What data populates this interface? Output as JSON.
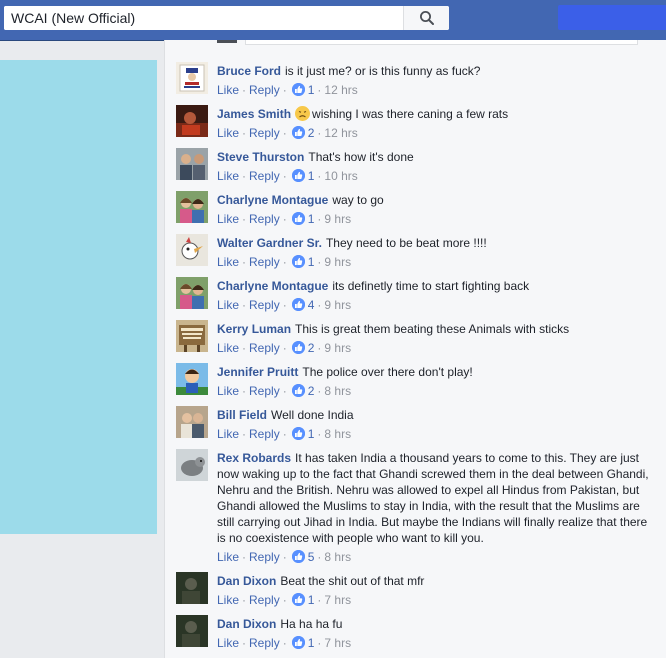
{
  "search": {
    "value": "WCAI (New Official)"
  },
  "actions": {
    "like": "Like",
    "reply": "Reply",
    "dot": "·"
  },
  "comments": [
    {
      "author": "Bruce Ford",
      "text": "is it just me? or is this funny as fuck?",
      "likes": "1",
      "time": "12 hrs",
      "avatar": "uncle-sam"
    },
    {
      "author": "James Smith",
      "text": "wishing I was there caning a few rats",
      "likes": "2",
      "time": "12 hrs",
      "avatar": "dark-red",
      "emoji": "persevering-face-icon"
    },
    {
      "author": "Steve Thurston",
      "text": "That's how it's done",
      "likes": "1",
      "time": "10 hrs",
      "avatar": "two-men"
    },
    {
      "author": "Charlyne Montague",
      "text": "way to go",
      "likes": "1",
      "time": "9 hrs",
      "avatar": "two-women"
    },
    {
      "author": "Walter Gardner Sr.",
      "text": "They need to be beat more !!!!",
      "likes": "1",
      "time": "9 hrs",
      "avatar": "cartoon-bird"
    },
    {
      "author": "Charlyne Montague",
      "text": "its definetly time to start fighting back",
      "likes": "4",
      "time": "9 hrs",
      "avatar": "two-women"
    },
    {
      "author": "Kerry Luman",
      "text": "This is great them beating these Animals with sticks",
      "likes": "2",
      "time": "9 hrs",
      "avatar": "sign"
    },
    {
      "author": "Jennifer Pruitt",
      "text": "The police over there don't play!",
      "likes": "2",
      "time": "8 hrs",
      "avatar": "cartoon-boy"
    },
    {
      "author": "Bill Field",
      "text": "Well done India",
      "likes": "1",
      "time": "8 hrs",
      "avatar": "couple"
    },
    {
      "author": "Rex Robards",
      "text": "It has taken India a thousand years to come to this. They are just now waking up to the fact that Ghandi screwed them in the deal between Ghandi, Nehru and the British. Nehru was allowed to expel all Hindus from Pakistan, but Ghandi allowed the Muslims to stay in India, with the result that the Muslims are still carrying out Jihad in India. But maybe the Indians will finally realize that there is no coexistence with people who want to kill you.",
      "likes": "5",
      "time": "8 hrs",
      "avatar": "animal"
    },
    {
      "author": "Dan Dixon",
      "text": "Beat the shit out of that mfr",
      "likes": "1",
      "time": "7 hrs",
      "avatar": "dark-figure"
    },
    {
      "author": "Dan Dixon",
      "text": "Ha ha ha fu",
      "likes": "1",
      "time": "7 hrs",
      "avatar": "dark-figure"
    }
  ]
}
